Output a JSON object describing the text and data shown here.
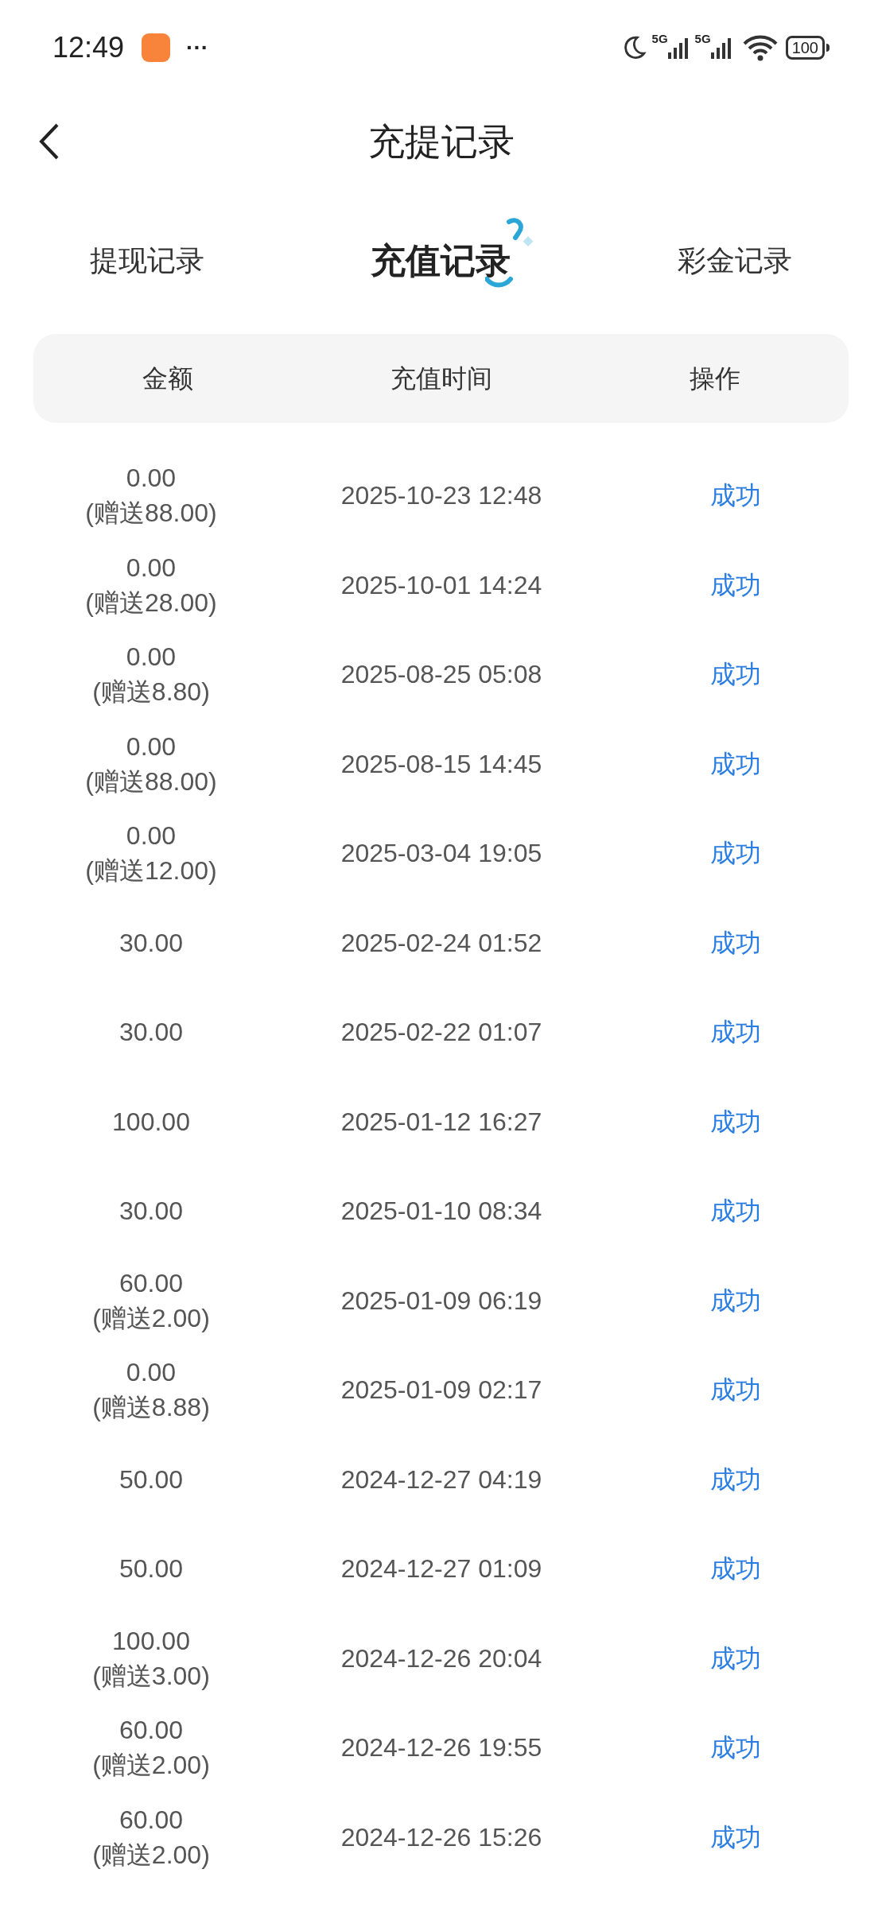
{
  "status_bar": {
    "time": "12:49",
    "more": "···",
    "network_1": "5G",
    "network_2": "5G",
    "battery": "100"
  },
  "header": {
    "title": "充提记录"
  },
  "tabs": [
    {
      "label": "提现记录",
      "selected": false
    },
    {
      "label": "充值记录",
      "selected": true
    },
    {
      "label": "彩金记录",
      "selected": false
    }
  ],
  "table": {
    "columns": [
      "金额",
      "充值时间",
      "操作"
    ],
    "rows": [
      {
        "amount": "0.00",
        "bonus": "(赠送88.00)",
        "time": "2025-10-23 12:48",
        "status": "成功"
      },
      {
        "amount": "0.00",
        "bonus": "(赠送28.00)",
        "time": "2025-10-01 14:24",
        "status": "成功"
      },
      {
        "amount": "0.00",
        "bonus": "(赠送8.80)",
        "time": "2025-08-25 05:08",
        "status": "成功"
      },
      {
        "amount": "0.00",
        "bonus": "(赠送88.00)",
        "time": "2025-08-15 14:45",
        "status": "成功"
      },
      {
        "amount": "0.00",
        "bonus": "(赠送12.00)",
        "time": "2025-03-04 19:05",
        "status": "成功"
      },
      {
        "amount": "30.00",
        "time": "2025-02-24 01:52",
        "status": "成功"
      },
      {
        "amount": "30.00",
        "time": "2025-02-22 01:07",
        "status": "成功"
      },
      {
        "amount": "100.00",
        "time": "2025-01-12 16:27",
        "status": "成功"
      },
      {
        "amount": "30.00",
        "time": "2025-01-10 08:34",
        "status": "成功"
      },
      {
        "amount": "60.00",
        "bonus": "(赠送2.00)",
        "time": "2025-01-09 06:19",
        "status": "成功"
      },
      {
        "amount": "0.00",
        "bonus": "(赠送8.88)",
        "time": "2025-01-09 02:17",
        "status": "成功"
      },
      {
        "amount": "50.00",
        "time": "2024-12-27 04:19",
        "status": "成功"
      },
      {
        "amount": "50.00",
        "time": "2024-12-27 01:09",
        "status": "成功"
      },
      {
        "amount": "100.00",
        "bonus": "(赠送3.00)",
        "time": "2024-12-26 20:04",
        "status": "成功"
      },
      {
        "amount": "60.00",
        "bonus": "(赠送2.00)",
        "time": "2024-12-26 19:55",
        "status": "成功"
      },
      {
        "amount": "60.00",
        "bonus": "(赠送2.00)",
        "time": "2024-12-26 15:26",
        "status": "成功"
      }
    ]
  }
}
